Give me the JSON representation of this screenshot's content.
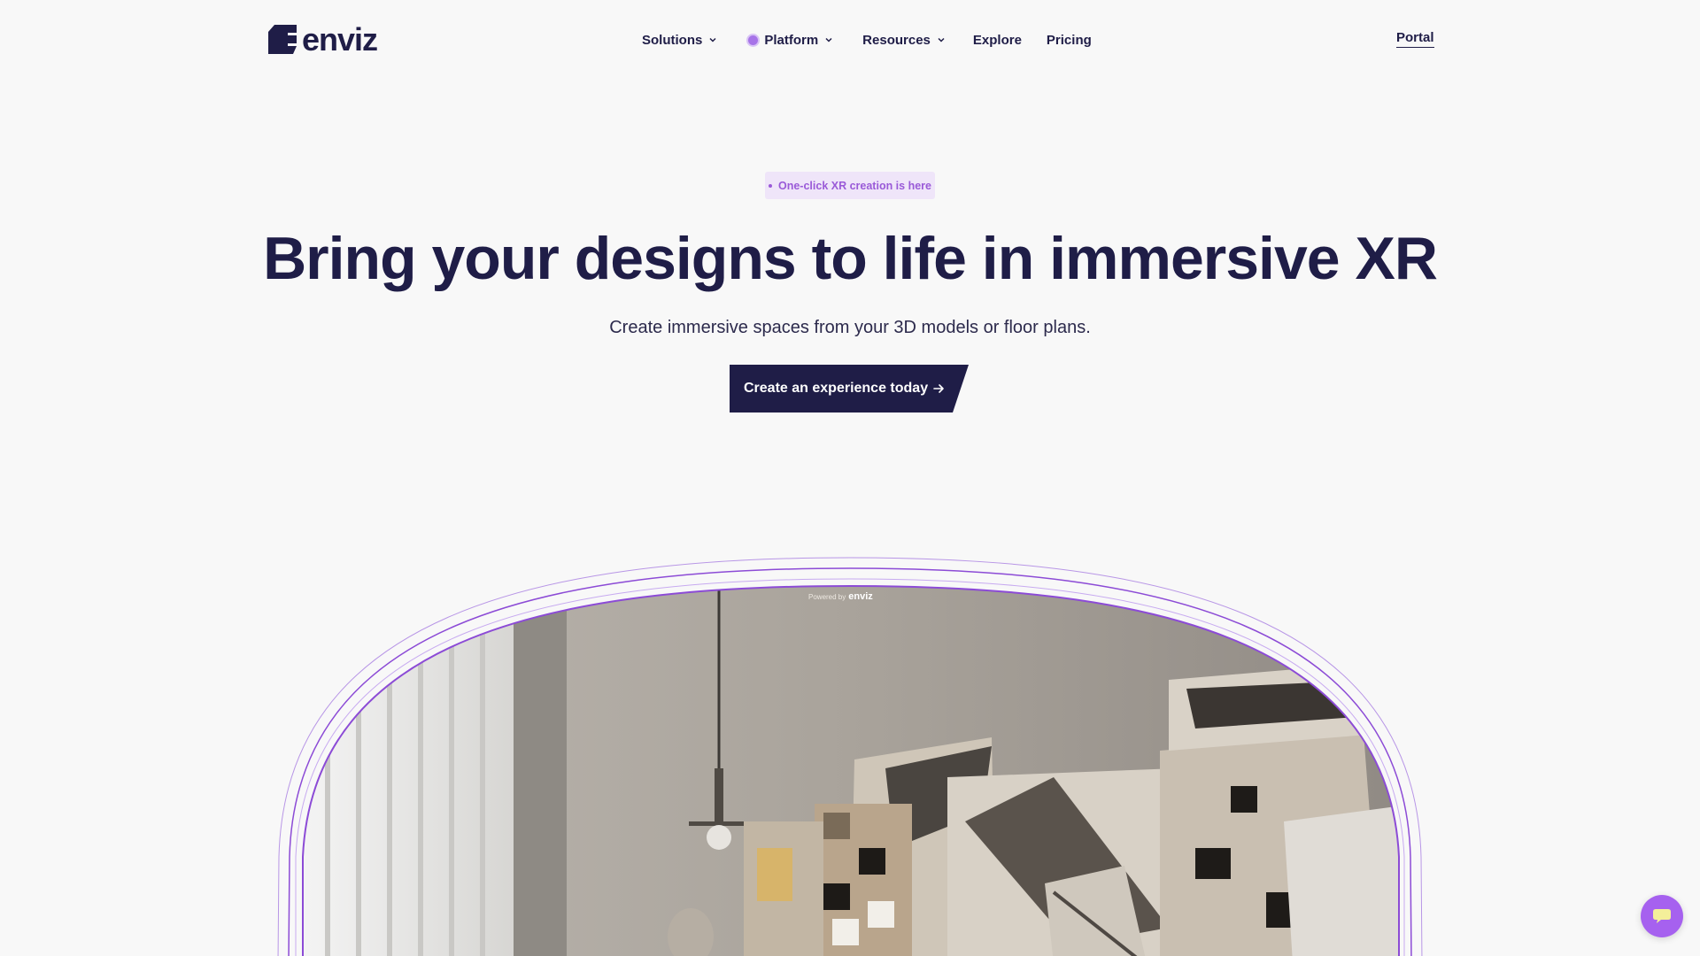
{
  "brand": {
    "name": "enviz",
    "color": "#1f1d47",
    "accent": "#a661ef"
  },
  "nav": {
    "items": [
      {
        "label": "Solutions",
        "has_dropdown": true
      },
      {
        "label": "Platform",
        "has_dropdown": true,
        "has_dot": true
      },
      {
        "label": "Resources",
        "has_dropdown": true
      },
      {
        "label": "Explore",
        "has_dropdown": false
      },
      {
        "label": "Pricing",
        "has_dropdown": false
      }
    ],
    "portal": "Portal"
  },
  "hero": {
    "badge": "One-click XR creation is here",
    "headline": "Bring your designs to life in immersive XR",
    "subhead": "Create immersive spaces from your 3D models or floor plans.",
    "cta": "Create an experience today"
  },
  "showcase": {
    "powered_by": "Powered by",
    "powered_brand": "enviz",
    "image_description_icon": "room-scene-image"
  },
  "chat": {
    "icon": "chat-bubble-icon"
  }
}
